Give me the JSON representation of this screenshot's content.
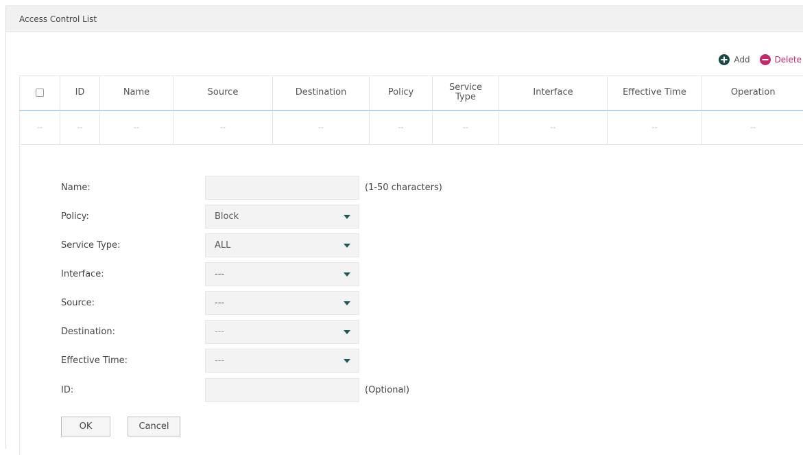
{
  "panel": {
    "title": "Access Control List"
  },
  "toolbar": {
    "add_label": "Add",
    "delete_label": "Delete"
  },
  "table": {
    "headers": [
      "ID",
      "Name",
      "Source",
      "Destination",
      "Policy",
      "Service Type",
      "Interface",
      "Effective Time",
      "Operation"
    ],
    "row": [
      "--",
      "--",
      "--",
      "--",
      "--",
      "--",
      "--",
      "--",
      "--",
      "--"
    ]
  },
  "form": {
    "name": {
      "label": "Name:",
      "value": "",
      "hint": "(1-50 characters)"
    },
    "policy": {
      "label": "Policy:",
      "value": "Block"
    },
    "service_type": {
      "label": "Service Type:",
      "value": "ALL"
    },
    "interface": {
      "label": "Interface:",
      "value": "---"
    },
    "source": {
      "label": "Source:",
      "value": "---"
    },
    "destination": {
      "label": "Destination:",
      "value": "---"
    },
    "effective_time": {
      "label": "Effective Time:",
      "value": "---"
    },
    "id": {
      "label": "ID:",
      "value": "",
      "hint": "(Optional)"
    },
    "ok_label": "OK",
    "cancel_label": "Cancel"
  },
  "colors": {
    "accent": "#1c4a4a",
    "delete": "#c5286a",
    "header_rule": "#b9d3e6"
  }
}
